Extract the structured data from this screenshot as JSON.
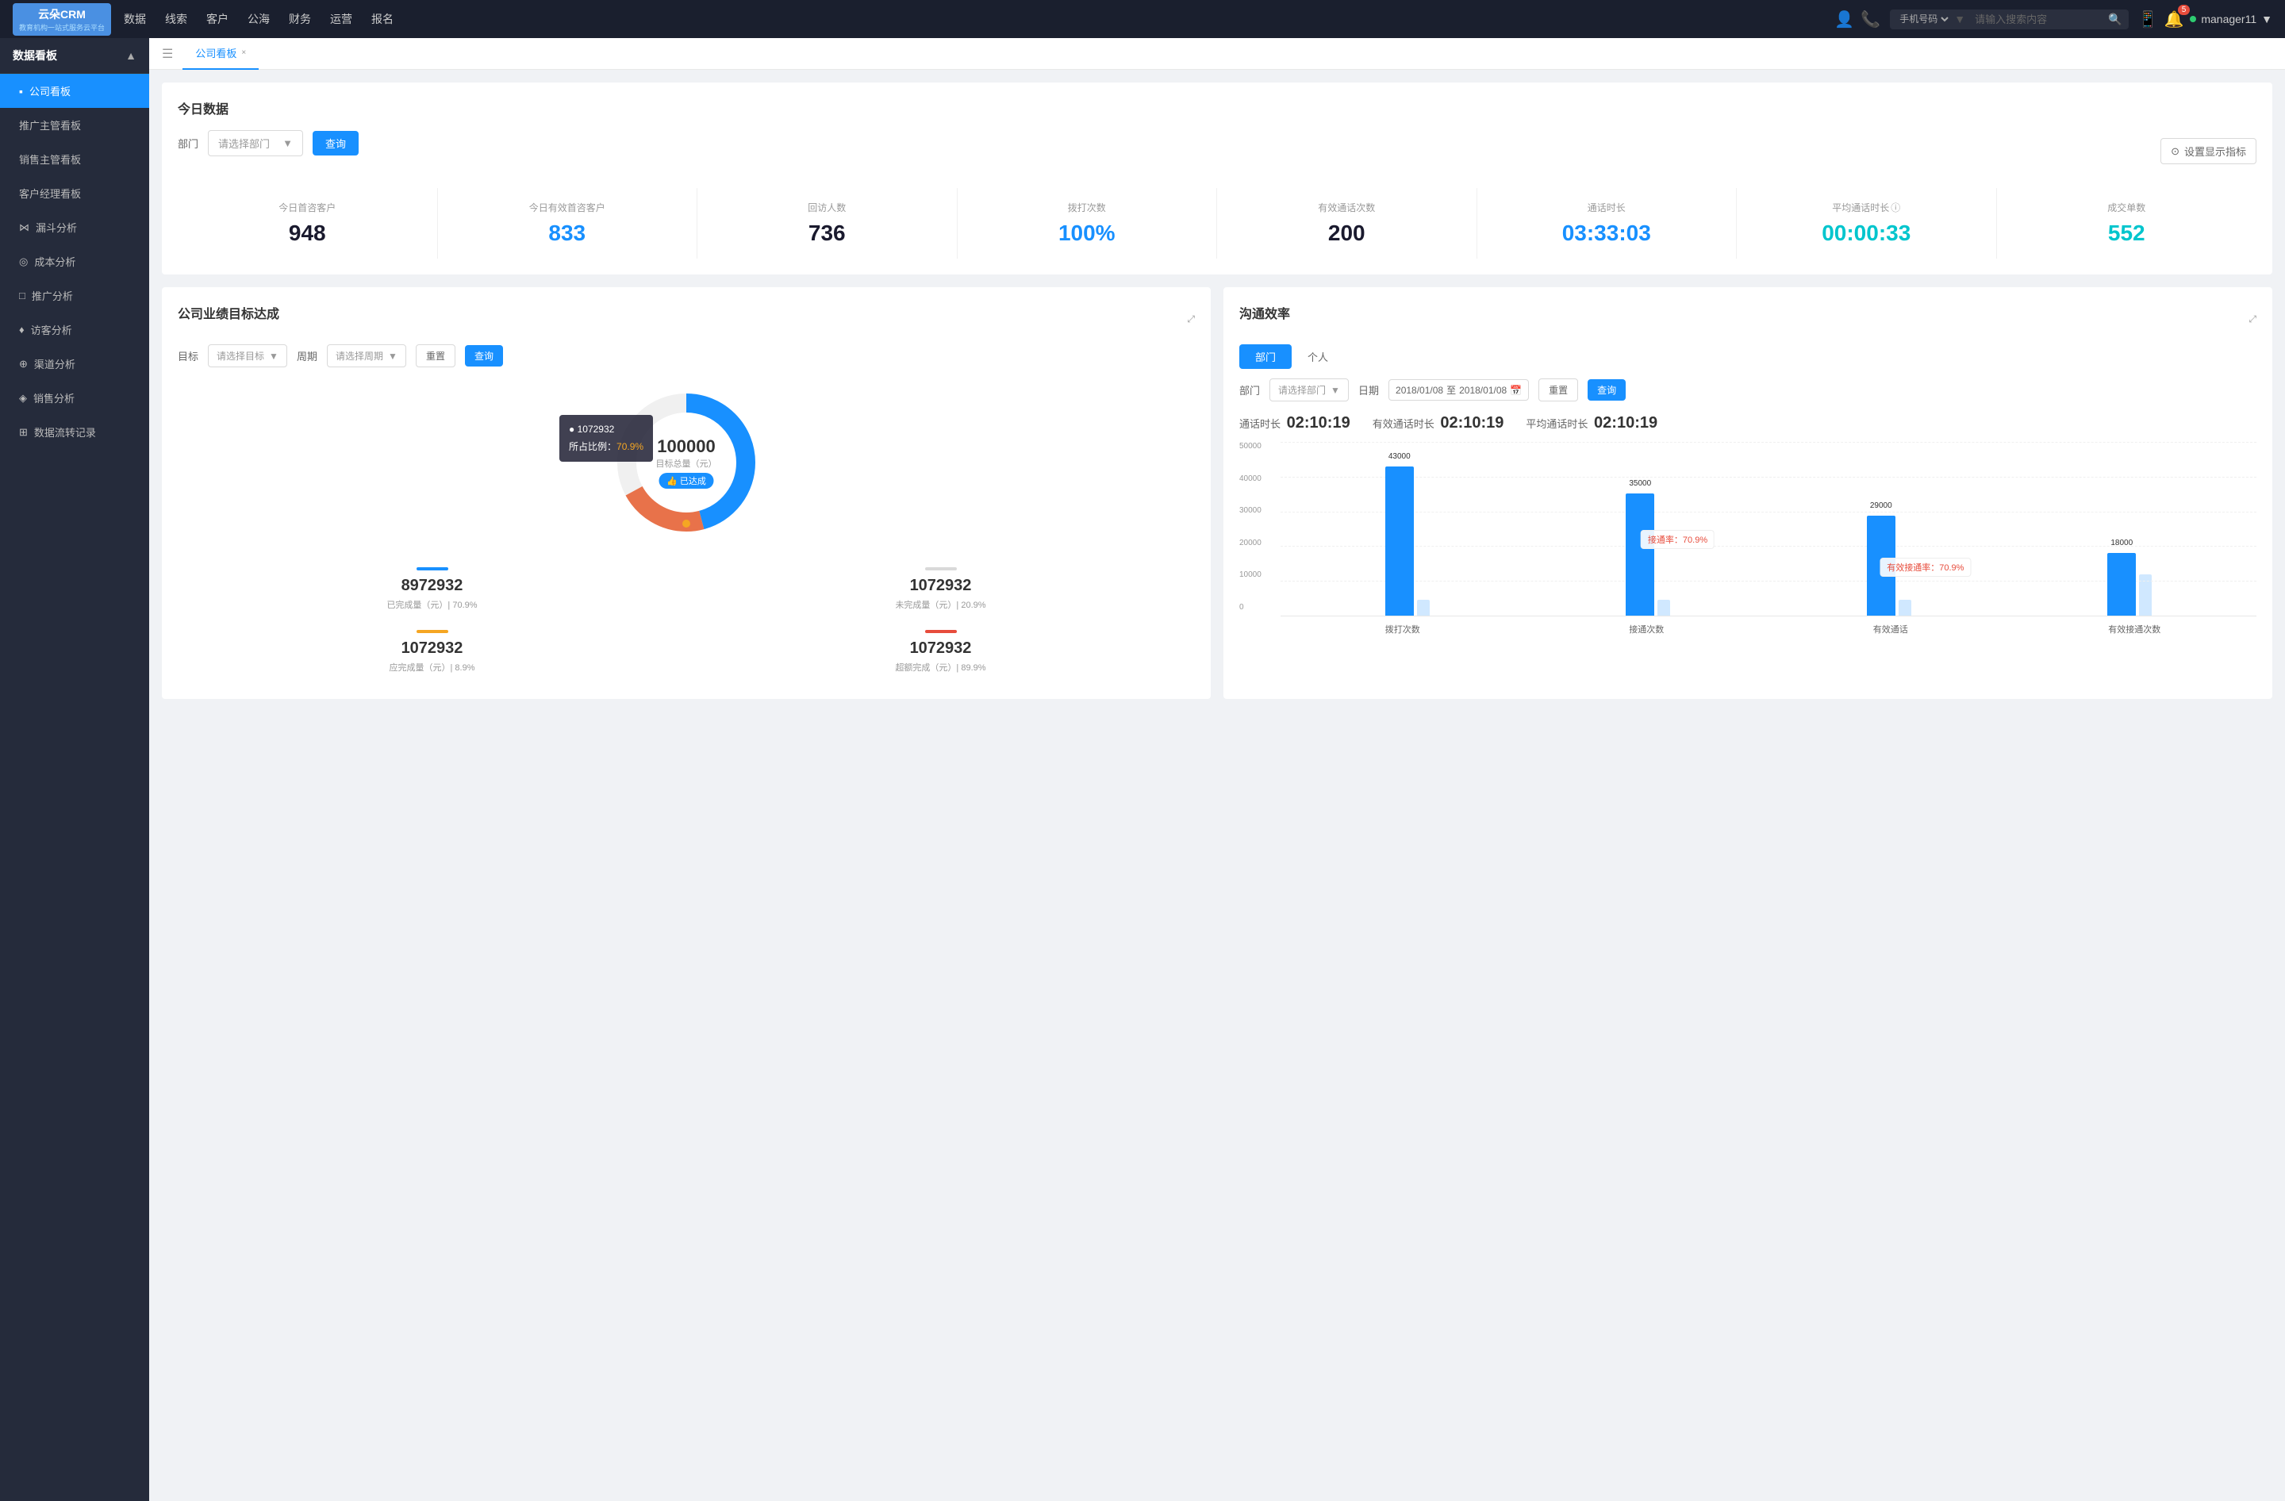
{
  "app": {
    "logo_main": "云朵CRM",
    "logo_sub": "教育机构一站式服务云平台"
  },
  "topnav": {
    "items": [
      "数据",
      "线索",
      "客户",
      "公海",
      "财务",
      "运营",
      "报名"
    ],
    "search_placeholder": "请输入搜索内容",
    "search_type": "手机号码",
    "user": "manager11"
  },
  "sidebar": {
    "title": "数据看板",
    "items": [
      {
        "label": "公司看板",
        "active": true
      },
      {
        "label": "推广主管看板",
        "active": false
      },
      {
        "label": "销售主管看板",
        "active": false
      },
      {
        "label": "客户经理看板",
        "active": false
      },
      {
        "label": "漏斗分析",
        "active": false
      },
      {
        "label": "成本分析",
        "active": false
      },
      {
        "label": "推广分析",
        "active": false
      },
      {
        "label": "访客分析",
        "active": false
      },
      {
        "label": "渠道分析",
        "active": false
      },
      {
        "label": "销售分析",
        "active": false
      },
      {
        "label": "数据流转记录",
        "active": false
      }
    ]
  },
  "tab": {
    "label": "公司看板",
    "close_icon": "×"
  },
  "today_data": {
    "title": "今日数据",
    "filter_label": "部门",
    "filter_placeholder": "请选择部门",
    "query_btn": "查询",
    "settings_btn": "设置显示指标",
    "stats": [
      {
        "label": "今日首咨客户",
        "value": "948",
        "color": "dark"
      },
      {
        "label": "今日有效首咨客户",
        "value": "833",
        "color": "blue"
      },
      {
        "label": "回访人数",
        "value": "736",
        "color": "dark"
      },
      {
        "label": "拨打次数",
        "value": "100%",
        "color": "blue"
      },
      {
        "label": "有效通话次数",
        "value": "200",
        "color": "dark"
      },
      {
        "label": "通话时长",
        "value": "03:33:03",
        "color": "blue"
      },
      {
        "label": "平均通话时长",
        "value": "00:00:33",
        "color": "cyan"
      },
      {
        "label": "成交单数",
        "value": "552",
        "color": "cyan"
      }
    ]
  },
  "business_target": {
    "title": "公司业绩目标达成",
    "target_label": "目标",
    "target_placeholder": "请选择目标",
    "period_label": "周期",
    "period_placeholder": "请选择周期",
    "reset_btn": "重置",
    "query_btn": "查询",
    "donut": {
      "total": "100000",
      "unit": "目标总量（元）",
      "badge": "👍 已达成",
      "tooltip_num": "1072932",
      "tooltip_pct_label": "所占比例：",
      "tooltip_pct": "70.9%"
    },
    "stats": [
      {
        "bar": "blue",
        "num": "8972932",
        "label": "已完成量（元）| 70.9%"
      },
      {
        "bar": "gray",
        "num": "1072932",
        "label": "未完成量（元）| 20.9%"
      },
      {
        "bar": "orange",
        "num": "1072932",
        "label": "应完成量（元）| 8.9%"
      },
      {
        "bar": "red",
        "num": "1072932",
        "label": "超额完成（元）| 89.9%"
      }
    ]
  },
  "efficiency": {
    "title": "沟通效率",
    "tabs": [
      "部门",
      "个人"
    ],
    "active_tab": "部门",
    "dept_label": "部门",
    "dept_placeholder": "请选择部门",
    "date_label": "日期",
    "date_from": "2018/01/08",
    "date_to": "2018/01/08",
    "reset_btn": "重置",
    "query_btn": "查询",
    "call_time_label": "通话时长",
    "call_time_val": "02:10:19",
    "effective_label": "有效通话时长",
    "effective_val": "02:10:19",
    "avg_label": "平均通话时长",
    "avg_val": "02:10:19",
    "chart": {
      "y_labels": [
        "0",
        "10000",
        "20000",
        "30000",
        "40000",
        "50000"
      ],
      "groups": [
        {
          "x_label": "拨打次数",
          "bars": [
            {
              "height_pct": 86,
              "value": "43000",
              "color": "blue"
            },
            {
              "height_pct": 0,
              "value": "",
              "color": "lightblue"
            }
          ],
          "annotation": null
        },
        {
          "x_label": "接通次数",
          "bars": [
            {
              "height_pct": 70,
              "value": "35000",
              "color": "blue"
            },
            {
              "height_pct": 0,
              "value": "",
              "color": "lightblue"
            }
          ],
          "annotation": {
            "text": "接通率：70.9%",
            "pct": 70
          }
        },
        {
          "x_label": "有效通话",
          "bars": [
            {
              "height_pct": 58,
              "value": "29000",
              "color": "blue"
            },
            {
              "height_pct": 0,
              "value": "",
              "color": "lightblue"
            }
          ],
          "annotation": {
            "text": "有效接通率：70.9%",
            "pct": 58
          }
        },
        {
          "x_label": "有效接通次数",
          "bars": [
            {
              "height_pct": 36,
              "value": "18000",
              "color": "blue"
            },
            {
              "height_pct": 24,
              "value": "",
              "color": "lightblue"
            }
          ],
          "annotation": null
        }
      ]
    }
  }
}
